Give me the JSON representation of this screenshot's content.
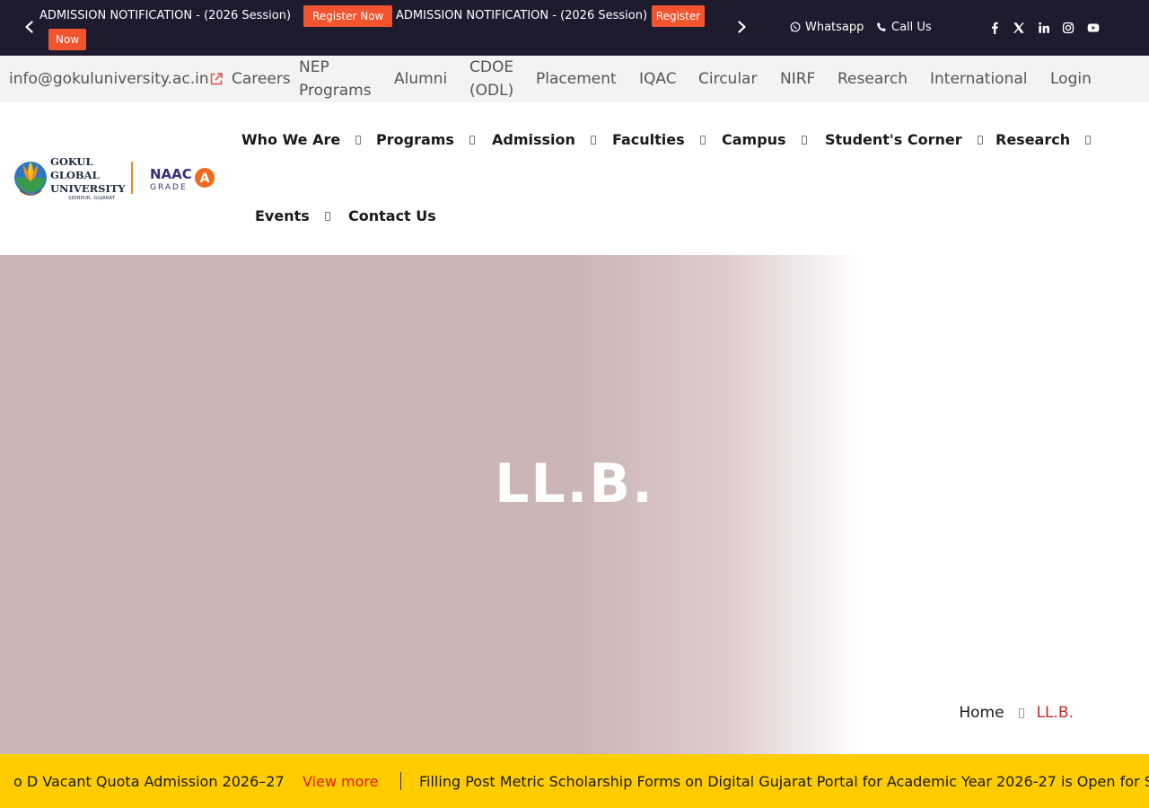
{
  "topbar": {
    "notices": [
      {
        "text": "ADMISSION NOTIFICATION - (2026 Session)",
        "button": "Register Now"
      },
      {
        "text": "ADMISSION NOTIFICATION - (2026 Session)",
        "button_line1": "Register",
        "button_line2": "Now"
      }
    ],
    "whatsapp_label": "Whatsapp",
    "call_label": "Call Us",
    "social_icons": [
      "facebook-icon",
      "x-icon",
      "linkedin-icon",
      "instagram-icon",
      "youtube-icon"
    ]
  },
  "linkbar": {
    "email": "info@gokuluniversity.ac.in",
    "links": {
      "careers": "Careers",
      "nep_line1": "NEP",
      "nep_line2": "Programs",
      "alumni": "Alumni",
      "cdoe_line1": "CDOE",
      "cdoe_line2": "(ODL)",
      "placement": "Placement",
      "iqac": "IQAC",
      "circular": "Circular",
      "nirf": "NIRF",
      "research": "Research",
      "international": "International",
      "login": "Login"
    }
  },
  "logo": {
    "line1": "GOKUL",
    "line2": "GLOBAL",
    "line3": "UNIVERSITY",
    "line4": "SIDHPUR, GUJARAT",
    "naac": "NAAC",
    "grade": "GRADE",
    "grade_letter": "A"
  },
  "nav": {
    "who_we_are": "Who We Are",
    "programs": "Programs",
    "admission": "Admission",
    "faculties": "Faculties",
    "campus": "Campus",
    "students_corner": "Student's Corner",
    "research": "Research",
    "events": "Events",
    "contact_us": "Contact Us"
  },
  "hero": {
    "title": "LL.B.",
    "breadcrumb_home": "Home",
    "breadcrumb_current": "LL.B."
  },
  "marquee": {
    "item1": "o D Vacant Quota Admission 2026–27",
    "item1_link": "View more",
    "item2": "Filling Post Metric Scholarship Forms on Digital Gujarat Portal for Academic Year 2026-27 is Open for S"
  },
  "colors": {
    "topbar_bg": "#1e1b2e",
    "accent_orange": "#f2542d",
    "marquee_bg": "#ffcc00",
    "breadcrumb_active": "#c62828",
    "hero_tint": "#cbb5b5"
  }
}
